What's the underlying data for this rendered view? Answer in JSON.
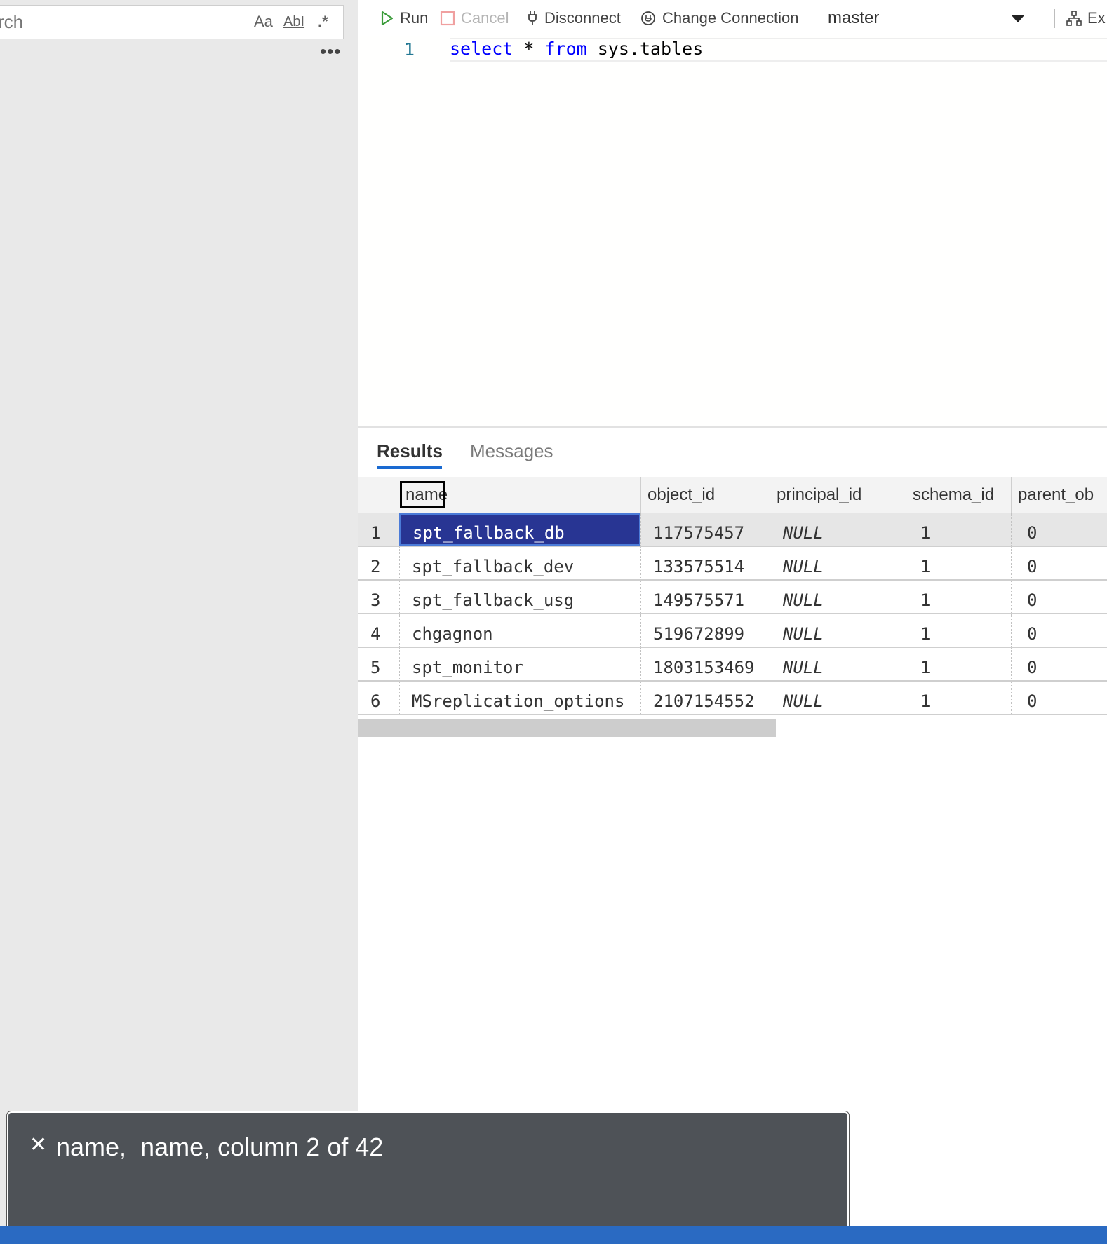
{
  "search": {
    "placeholder": "rch",
    "match_case_label": "Aa",
    "whole_word_label": "AbI",
    "regex_label": ".*",
    "more_label": "•••"
  },
  "toolbar": {
    "run_label": "Run",
    "cancel_label": "Cancel",
    "disconnect_label": "Disconnect",
    "change_connection_label": "Change Connection",
    "database_value": "master",
    "explain_label": "Ex"
  },
  "editor": {
    "line_number": "1",
    "code_kw1": "select",
    "code_mid": " * ",
    "code_kw2": "from",
    "code_rest": " sys.tables"
  },
  "results": {
    "tabs": [
      {
        "label": "Results"
      },
      {
        "label": "Messages"
      }
    ],
    "columns": [
      "name",
      "object_id",
      "principal_id",
      "schema_id",
      "parent_ob"
    ],
    "rows": [
      {
        "n": "1",
        "name": "spt_fallback_db",
        "object_id": "117575457",
        "principal_id": "NULL",
        "schema_id": "1",
        "parent": "0"
      },
      {
        "n": "2",
        "name": "spt_fallback_dev",
        "object_id": "133575514",
        "principal_id": "NULL",
        "schema_id": "1",
        "parent": "0"
      },
      {
        "n": "3",
        "name": "spt_fallback_usg",
        "object_id": "149575571",
        "principal_id": "NULL",
        "schema_id": "1",
        "parent": "0"
      },
      {
        "n": "4",
        "name": "chgagnon",
        "object_id": "519672899",
        "principal_id": "NULL",
        "schema_id": "1",
        "parent": "0"
      },
      {
        "n": "5",
        "name": "spt_monitor",
        "object_id": "1803153469",
        "principal_id": "NULL",
        "schema_id": "1",
        "parent": "0"
      },
      {
        "n": "6",
        "name": "MSreplication_options",
        "object_id": "2107154552",
        "principal_id": "NULL",
        "schema_id": "1",
        "parent": "0"
      }
    ]
  },
  "notification": {
    "close_glyph": "✕",
    "message": "name,  name, column 2 of 42"
  },
  "colors": {
    "selected_cell": "#283593",
    "tab_accent": "#1a6ad1",
    "status_bar": "#2a6ac2",
    "toast_bg": "#4e5257"
  }
}
